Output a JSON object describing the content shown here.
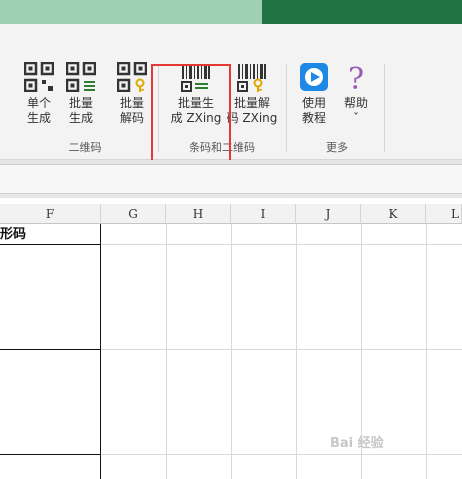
{
  "ribbon": {
    "qr_group": {
      "label": "二维码",
      "buttons": [
        {
          "line1": "单个",
          "line2": "生成",
          "icon": "qr-code-icon"
        },
        {
          "line1": "批量",
          "line2": "生成",
          "icon": "qr-code-batch-icon"
        },
        {
          "line1": "批量",
          "line2": "解码",
          "icon": "qr-code-decode-icon"
        }
      ]
    },
    "barcode_group": {
      "label": "条码和二维码",
      "buttons": [
        {
          "line1": "批量生",
          "line2": "成 ZXing",
          "icon": "barcode-batch-icon"
        },
        {
          "line1": "批量解",
          "line2": "码 ZXing",
          "icon": "barcode-decode-icon"
        }
      ]
    },
    "more_group": {
      "label": "更多",
      "buttons": [
        {
          "line1": "使用",
          "line2": "教程",
          "icon": "play-tutorial-icon"
        },
        {
          "line1": "帮助",
          "line2": "ˇ",
          "icon": "help-question-icon"
        }
      ]
    }
  },
  "sheet": {
    "columns": [
      "F",
      "G",
      "H",
      "I",
      "J",
      "K",
      "L"
    ],
    "cell_f1": "条形码"
  },
  "watermark": "Bai 经验",
  "colors": {
    "excel_green": "#217346",
    "highlight_red": "#e53935",
    "help_purple": "#9b59b6",
    "play_blue": "#1e88e5"
  }
}
